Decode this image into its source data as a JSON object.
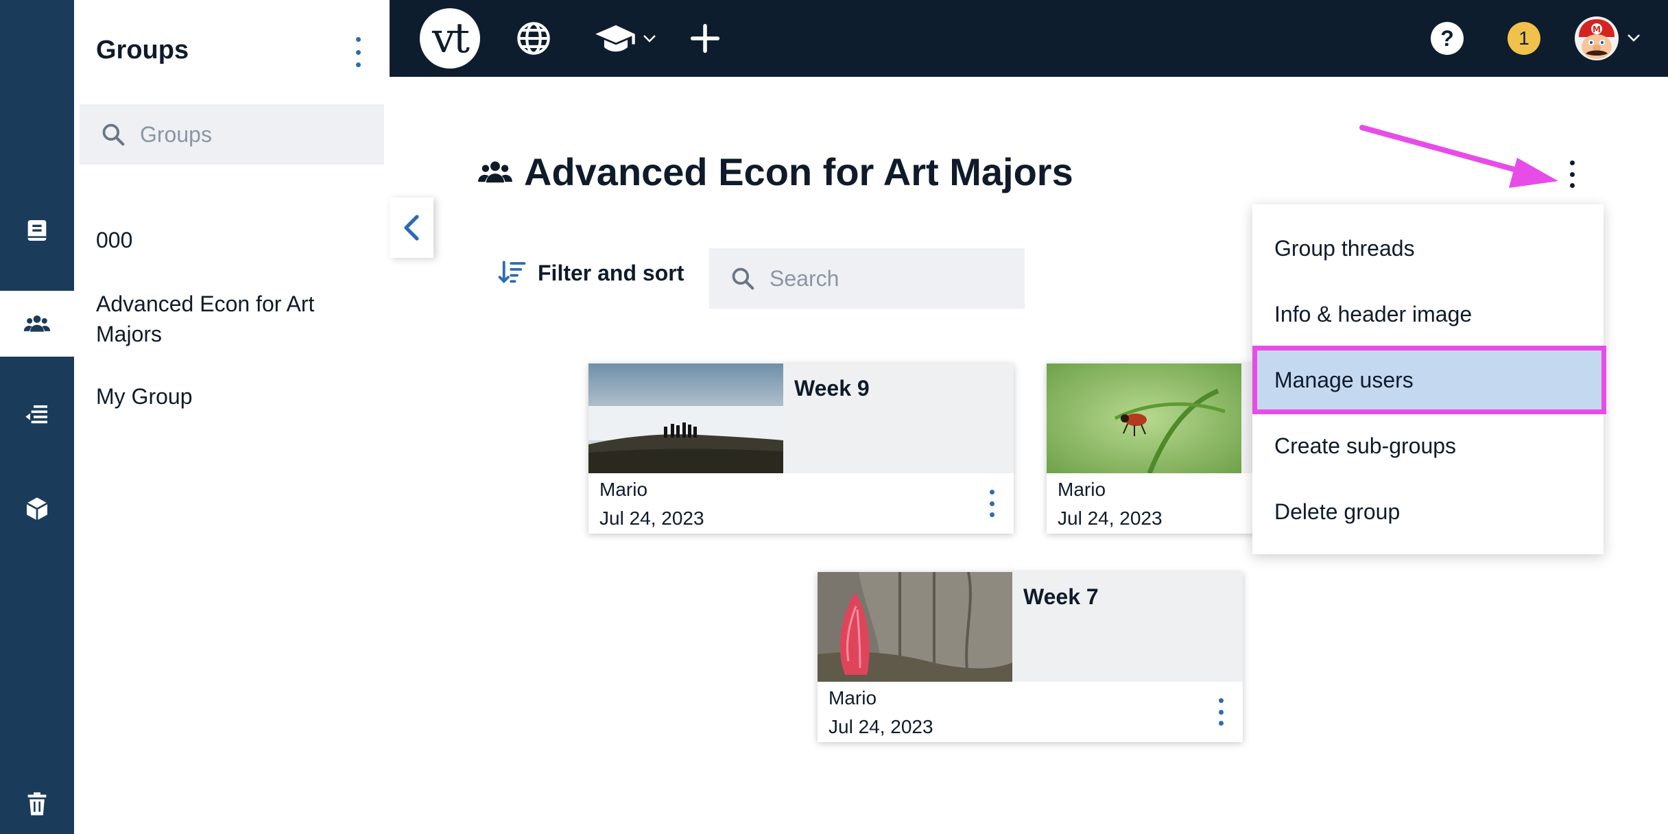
{
  "groups_panel": {
    "title": "Groups",
    "search_placeholder": "Groups",
    "items": [
      {
        "label": "000"
      },
      {
        "label": "Advanced Econ for Art Majors"
      },
      {
        "label": "My Group"
      }
    ]
  },
  "topbar": {
    "logo_text": "vt",
    "help_label": "?",
    "notification_count": "1"
  },
  "main": {
    "title": "Advanced Econ for Art Majors",
    "filter_label": "Filter and sort",
    "search_placeholder": "Search",
    "cards": [
      {
        "title": "Week 9",
        "author": "Mario",
        "date": "Jul 24, 2023"
      },
      {
        "title": "",
        "author": "Mario",
        "date": "Jul 24, 2023"
      },
      {
        "title": "Week 7",
        "author": "Mario",
        "date": "Jul 24, 2023"
      }
    ]
  },
  "menu": {
    "items": [
      {
        "label": "Group threads"
      },
      {
        "label": "Info & header image"
      },
      {
        "label": "Manage users"
      },
      {
        "label": "Create sub-groups"
      },
      {
        "label": "Delete group"
      }
    ]
  },
  "colors": {
    "rail": "#1b3b5a",
    "topbar": "#0e1d2e",
    "accent": "#2b6cb0",
    "highlight_fill": "#c4d9ef",
    "annotation_magenta": "#e84ce8",
    "notification": "#f0c24b"
  },
  "icons": [
    "notebook-icon",
    "people-icon",
    "timeline-icon",
    "cube-icon",
    "trash-icon",
    "globe-icon",
    "graduation-cap-icon",
    "plus-icon",
    "search-icon",
    "sort-icon",
    "chevron-left-icon",
    "kebab-icon"
  ]
}
